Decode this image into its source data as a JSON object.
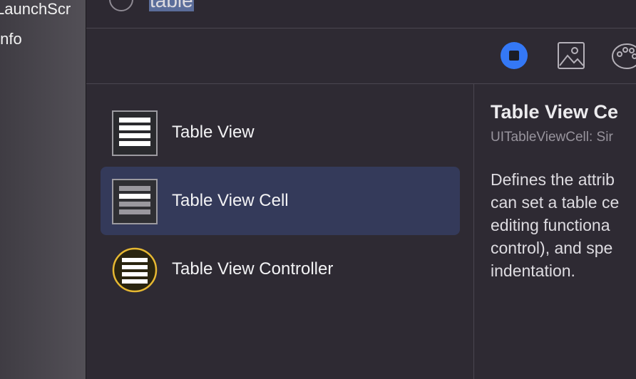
{
  "background_sidebar": {
    "items": [
      "LaunchScr",
      "Info"
    ]
  },
  "search": {
    "query": "table"
  },
  "toolbar": {
    "buttons": [
      {
        "name": "objects",
        "icon": "square-in-circle-icon",
        "active": true
      },
      {
        "name": "media",
        "icon": "image-icon",
        "active": false
      },
      {
        "name": "colors",
        "icon": "palette-icon",
        "active": false
      }
    ]
  },
  "library": {
    "items": [
      {
        "label": "Table View",
        "icon": "table-view-icon",
        "selected": false
      },
      {
        "label": "Table View Cell",
        "icon": "table-view-cell-icon",
        "selected": true
      },
      {
        "label": "Table View Controller",
        "icon": "table-view-controller-icon",
        "selected": false
      }
    ]
  },
  "detail": {
    "title": "Table View Ce",
    "subtitle": "UITableViewCell: Sir",
    "description_lines": [
      "Defines the attrib",
      "can set a table ce",
      "editing functiona",
      "control), and spe",
      "indentation."
    ]
  },
  "colors": {
    "accent": "#3478f6",
    "selection": "#343a5a",
    "controller_ring": "#e6b832"
  }
}
